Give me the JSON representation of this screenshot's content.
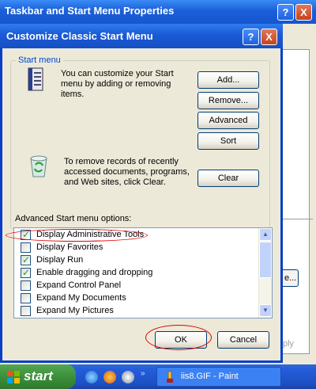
{
  "back_window": {
    "title": "Taskbar and Start Menu Properties",
    "help_glyph": "?",
    "close_glyph": "X",
    "fragment_button_text": "e...",
    "fragment_apply_text": "ply"
  },
  "dialog": {
    "title": "Customize Classic Start Menu",
    "help_glyph": "?",
    "close_glyph": "X",
    "group_label": "Start menu",
    "customize_text": "You can customize your Start menu by adding or removing items.",
    "clear_text": "To remove records of recently accessed documents, programs, and Web sites, click Clear.",
    "buttons": {
      "add": "Add...",
      "remove": "Remove...",
      "advanced": "Advanced",
      "sort": "Sort",
      "clear": "Clear",
      "ok": "OK",
      "cancel": "Cancel"
    },
    "options_label": "Advanced Start menu options:",
    "options": [
      {
        "label": "Display Administrative Tools",
        "checked": true
      },
      {
        "label": "Display Favorites",
        "checked": false
      },
      {
        "label": "Display Run",
        "checked": true
      },
      {
        "label": "Enable dragging and dropping",
        "checked": true
      },
      {
        "label": "Expand Control Panel",
        "checked": false
      },
      {
        "label": "Expand My Documents",
        "checked": false
      },
      {
        "label": "Expand My Pictures",
        "checked": false
      }
    ],
    "check_glyph": "✓"
  },
  "taskbar": {
    "start_label": "start",
    "task_label": "iis8.GIF - Paint"
  },
  "icons": {
    "start_menu_settings": "start-menu-settings-icon",
    "recycle_bin": "recycle-bin-icon",
    "windows_logo": "windows-logo-icon",
    "ie": "internet-explorer-icon",
    "firefox": "firefox-icon",
    "quicklaunch_3": "quick-launch-icon",
    "paint": "paint-icon"
  },
  "colors": {
    "title_blue": "#1B5FD8",
    "group_label_blue": "#0046D5",
    "highlight_red": "#E00000",
    "start_green": "#3C8F3B",
    "check_green": "#21A121"
  }
}
